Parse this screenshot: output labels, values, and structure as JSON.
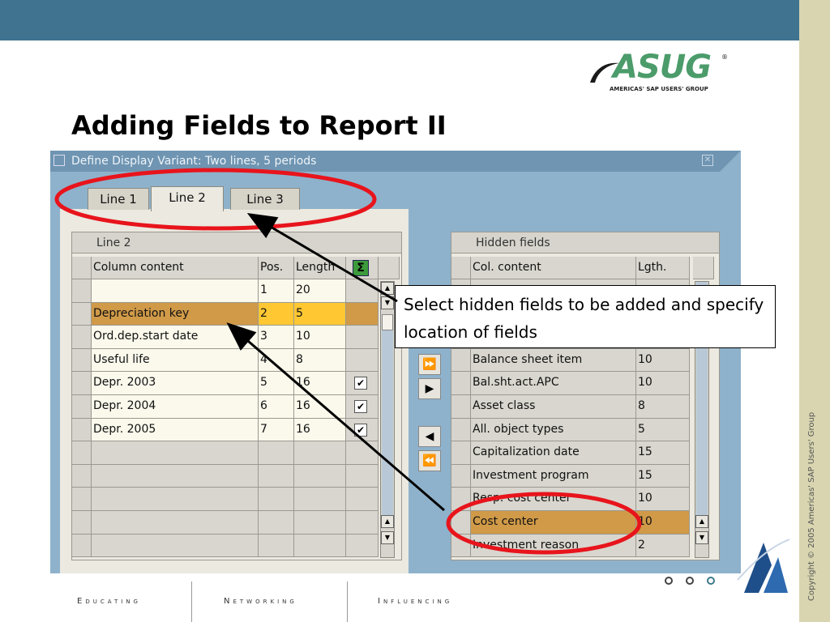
{
  "slide": {
    "title": "Adding Fields to Report II",
    "copyright": "Copyright © 2005 Americas' SAP Users' Group",
    "footer": [
      "Educating",
      "Networking",
      "Influencing"
    ],
    "nav_dots": [
      "circle",
      "circle",
      "circle"
    ],
    "callout": "Select hidden fields to be added and specify location of fields"
  },
  "logo": {
    "name": "ASUG",
    "registered": "®",
    "tagline": "AMERICAS' SAP USERS' GROUP"
  },
  "window": {
    "title": "Define Display Variant: Two lines, 5 periods",
    "close_icon": "close-icon"
  },
  "tabs": [
    {
      "label": "Line 1",
      "active": false
    },
    {
      "label": "Line 2",
      "active": true
    },
    {
      "label": "Line 3",
      "active": false
    }
  ],
  "left_table": {
    "title": "Line 2",
    "headers": {
      "content": "Column content",
      "pos": "Pos.",
      "length": "Length",
      "sum": "Σ"
    },
    "rows": [
      {
        "content": "",
        "pos": "1",
        "length": "20",
        "checked": false
      },
      {
        "content": "Depreciation key",
        "pos": "2",
        "length": "5",
        "checked": false
      },
      {
        "content": "Ord.dep.start date",
        "pos": "3",
        "length": "10",
        "checked": false
      },
      {
        "content": "Useful life",
        "pos": "4",
        "length": "8",
        "checked": false
      },
      {
        "content": "Depr. 2003",
        "pos": "5",
        "length": "16",
        "checked": true
      },
      {
        "content": "Depr. 2004",
        "pos": "6",
        "length": "16",
        "checked": true
      },
      {
        "content": "Depr. 2005",
        "pos": "7",
        "length": "16",
        "checked": true
      },
      {
        "content": "",
        "pos": "",
        "length": "",
        "checked": false
      },
      {
        "content": "",
        "pos": "",
        "length": "",
        "checked": false
      },
      {
        "content": "",
        "pos": "",
        "length": "",
        "checked": false
      },
      {
        "content": "",
        "pos": "",
        "length": "",
        "checked": false
      },
      {
        "content": "",
        "pos": "",
        "length": "",
        "checked": false
      }
    ]
  },
  "right_table": {
    "title": "Hidden fields",
    "headers": {
      "content": "Col. content",
      "length": "Lgth."
    },
    "rows": [
      {
        "content": "",
        "length": ""
      },
      {
        "content": "",
        "length": ""
      },
      {
        "content": "",
        "length": ""
      },
      {
        "content": "Balance sheet item",
        "length": "10"
      },
      {
        "content": "Bal.sht.act.APC",
        "length": "10"
      },
      {
        "content": "Asset class",
        "length": "8"
      },
      {
        "content": "All. object types",
        "length": "5"
      },
      {
        "content": "Capitalization date",
        "length": "15"
      },
      {
        "content": "Investment program",
        "length": "15"
      },
      {
        "content": "Resp. cost center",
        "length": "10"
      },
      {
        "content": "Cost center",
        "length": "10"
      },
      {
        "content": "Investment reason",
        "length": "2"
      }
    ]
  },
  "move_buttons": {
    "add_all": "⏩",
    "add": "▶",
    "remove": "◀",
    "remove_all": "⏪"
  },
  "colors": {
    "selected_row": "#ffc832",
    "selected_row_dim": "#d09a48",
    "highlight_oval": "#e8141c"
  }
}
